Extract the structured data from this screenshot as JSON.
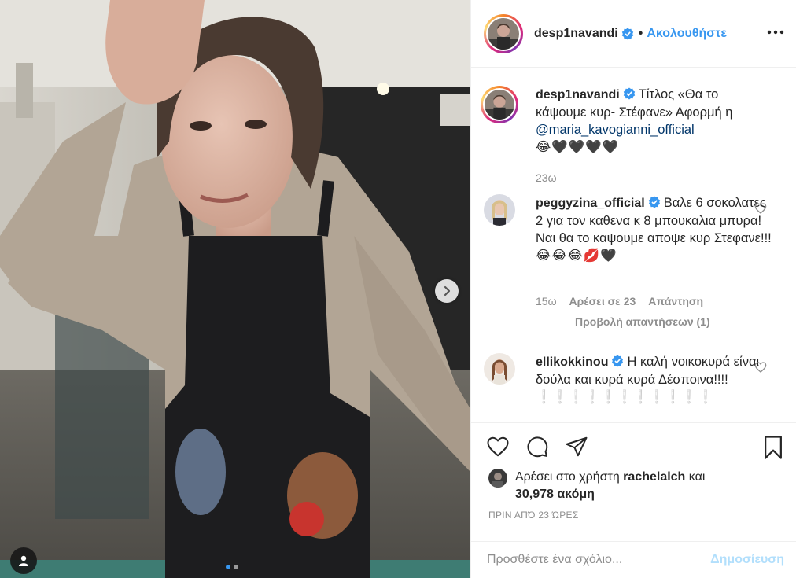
{
  "post": {
    "author": "desp1navandi",
    "follow_separator": "•",
    "follow_label": "Ακολουθήστε",
    "more_icon": "more-horizontal-icon"
  },
  "caption": {
    "username": "desp1navandi",
    "text_before": "Τίτλος «Θα το κάψουμε κυρ- Στέφανε» Αφορμή η ",
    "mention": "@maria_kavogianni_official",
    "emojis": "😂🖤🖤🖤🖤",
    "time": "23ω"
  },
  "comments": [
    {
      "username": "peggyzina_official",
      "text": "Βαλε 6 σοκολατες 2 για τον καθενα κ 8 μπουκαλια μπυρα! Ναι θα το καψουμε αποψε κυρ Στεφανε!!!",
      "emojis": "😂😂😂💋🖤",
      "time": "15ω",
      "likes": "Αρέσει σε 23",
      "reply": "Απάντηση",
      "view_replies": "Προβολή απαντήσεων (1)"
    },
    {
      "username": "ellikokkinou",
      "text": "Η καλή νοικοκυρά είναι δούλα και κυρά κυρά Δέσποινα!!!!",
      "emojis": "❕❕❕❕❕❕❕❕❕❕❕"
    }
  ],
  "likes": {
    "prefix": "Αρέσει στο χρήστη",
    "user": "rachelalch",
    "conjunction": "και",
    "count": "30,978 ακόμη"
  },
  "time_ago": "ΠΡΙΝ ΑΠΌ 23 ΏΡΕΣ",
  "add_comment": {
    "placeholder": "Προσθέστε ένα σχόλιο...",
    "post_label": "Δημοσίευση"
  },
  "carousel": {
    "current": 1,
    "total": 2
  },
  "colors": {
    "link": "#3897f0",
    "muted": "#8e8e8e",
    "text": "#262626",
    "post_disabled": "#b2dffc"
  }
}
